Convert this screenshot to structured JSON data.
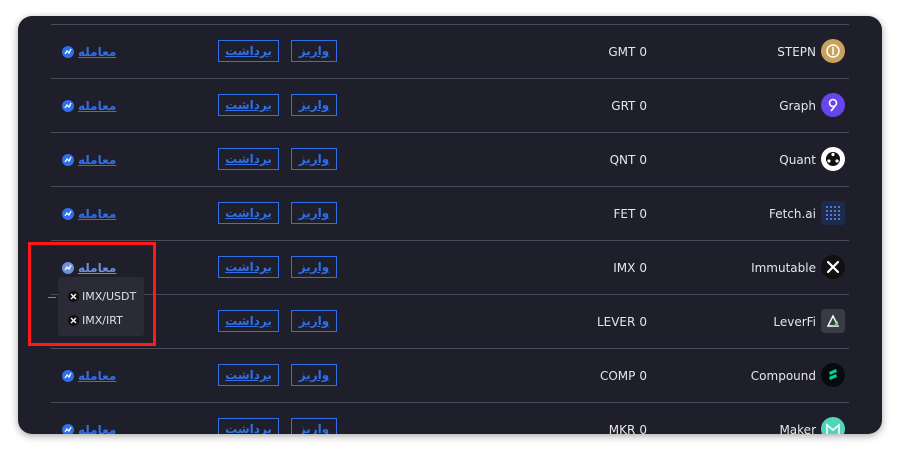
{
  "labels": {
    "trade": "معامله",
    "withdraw": "برداشت",
    "deposit": "واریز"
  },
  "rows": [
    {
      "name": "STEPN",
      "symbol": "GMT",
      "balance": "0",
      "icon": "stepn-icon",
      "color": "#c9a25c"
    },
    {
      "name": "Graph",
      "symbol": "GRT",
      "balance": "0",
      "icon": "graph-icon",
      "color": "#6747ed"
    },
    {
      "name": "Quant",
      "symbol": "QNT",
      "balance": "0",
      "icon": "quant-icon",
      "color": "#ffffff"
    },
    {
      "name": "Fetch.ai",
      "symbol": "FET",
      "balance": "0",
      "icon": "fetch-icon",
      "color": "#1d2b4a"
    },
    {
      "name": "Immutable",
      "symbol": "IMX",
      "balance": "0",
      "icon": "immutable-icon",
      "color": "#111111"
    },
    {
      "name": "LeverFi",
      "symbol": "LEVER",
      "balance": "0",
      "icon": "leverfi-icon",
      "color": "#3a3b46"
    },
    {
      "name": "Compound",
      "symbol": "COMP",
      "balance": "0",
      "icon": "compound-icon",
      "color": "#070a0e"
    },
    {
      "name": "Maker",
      "symbol": "MKR",
      "balance": "0",
      "icon": "maker-icon",
      "color": "#4fd6ba"
    }
  ],
  "dropdown": {
    "items": [
      {
        "label": "IMX/USDT"
      },
      {
        "label": "IMX/IRT"
      }
    ]
  },
  "colors": {
    "accent": "#2f6fe8",
    "background": "#1e1f2b",
    "highlight": "#ff1a1a"
  }
}
